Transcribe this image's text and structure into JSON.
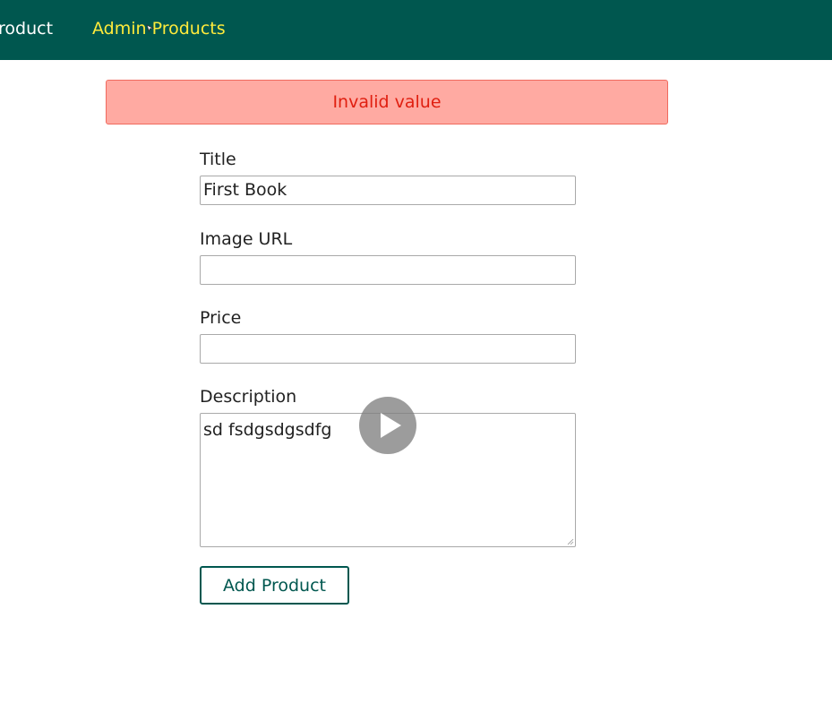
{
  "nav": {
    "items": [
      {
        "label": "roduct"
      },
      {
        "label": "Admin Products"
      }
    ]
  },
  "alert": {
    "message": "Invalid value"
  },
  "form": {
    "title": {
      "label": "Title",
      "value": "First Book"
    },
    "image_url": {
      "label": "Image URL",
      "value": ""
    },
    "price": {
      "label": "Price",
      "value": ""
    },
    "description": {
      "label": "Description",
      "value": "sd fsdgsdgsdfg"
    },
    "submit_label": "Add Product"
  },
  "colors": {
    "header_bg": "#00574f",
    "nav_active": "#ffeb3b",
    "alert_bg": "#ffaaa2",
    "alert_text": "#e01f10"
  },
  "icons": {
    "cursor": "cursor-icon",
    "play": "play-icon",
    "resize": "resize-handle-icon"
  }
}
